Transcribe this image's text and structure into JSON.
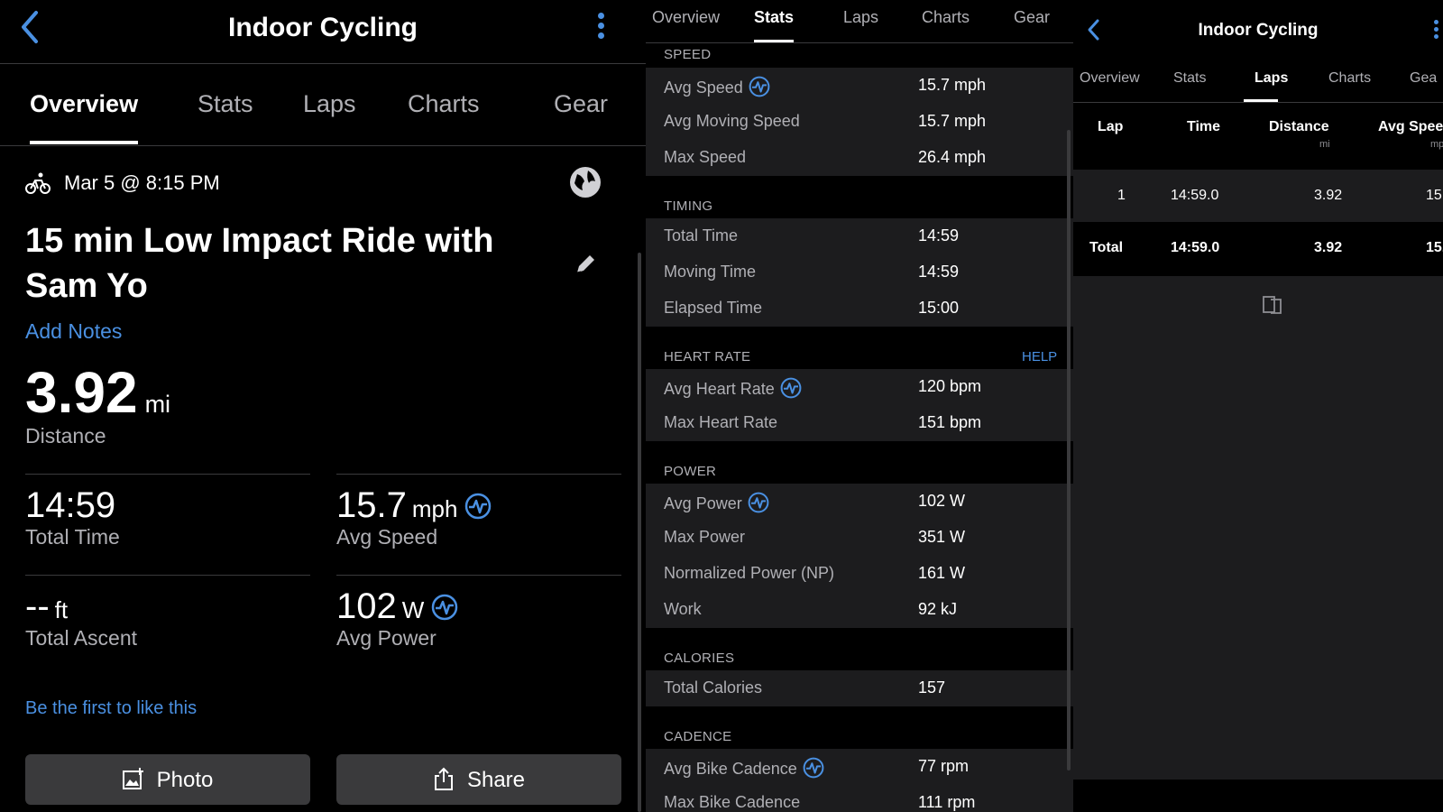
{
  "overview_panel": {
    "title": "Indoor Cycling",
    "tabs": [
      "Overview",
      "Stats",
      "Laps",
      "Charts",
      "Gear"
    ],
    "active_tab": "Overview",
    "date": "Mar 5 @ 8:15 PM",
    "activity_title": "15 min Low Impact Ride with Sam Yo",
    "add_notes": "Add Notes",
    "distance": {
      "value": "3.92",
      "unit": "mi",
      "label": "Distance"
    },
    "stats": [
      {
        "value": "14:59",
        "unit": "",
        "label": "Total Time"
      },
      {
        "value": "15.7",
        "unit": "mph",
        "label": "Avg Speed"
      },
      {
        "value": "--",
        "unit": "ft",
        "label": "Total Ascent"
      },
      {
        "value": "102",
        "unit": "W",
        "label": "Avg Power"
      }
    ],
    "like_text": "Be the first to like this",
    "photo_button": "Photo",
    "share_button": "Share"
  },
  "stats_panel": {
    "tabs": [
      "Overview",
      "Stats",
      "Laps",
      "Charts",
      "Gear"
    ],
    "active_tab": "Stats",
    "sections": {
      "speed": {
        "title": "SPEED",
        "rows": [
          {
            "label": "Avg Speed",
            "value": "15.7 mph"
          },
          {
            "label": "Avg Moving Speed",
            "value": "15.7 mph"
          },
          {
            "label": "Max Speed",
            "value": "26.4 mph"
          }
        ]
      },
      "timing": {
        "title": "TIMING",
        "rows": [
          {
            "label": "Total Time",
            "value": "14:59"
          },
          {
            "label": "Moving Time",
            "value": "14:59"
          },
          {
            "label": "Elapsed Time",
            "value": "15:00"
          }
        ]
      },
      "heart_rate": {
        "title": "HEART RATE",
        "help": "HELP",
        "rows": [
          {
            "label": "Avg Heart Rate",
            "value": "120 bpm"
          },
          {
            "label": "Max Heart Rate",
            "value": "151 bpm"
          }
        ]
      },
      "power": {
        "title": "POWER",
        "rows": [
          {
            "label": "Avg Power",
            "value": "102 W"
          },
          {
            "label": "Max Power",
            "value": "351 W"
          },
          {
            "label": "Normalized Power (NP)",
            "value": "161 W"
          },
          {
            "label": "Work",
            "value": "92 kJ"
          }
        ]
      },
      "calories": {
        "title": "CALORIES",
        "rows": [
          {
            "label": "Total Calories",
            "value": "157"
          }
        ]
      },
      "cadence": {
        "title": "CADENCE",
        "rows": [
          {
            "label": "Avg Bike Cadence",
            "value": "77 rpm"
          },
          {
            "label": "Max Bike Cadence",
            "value": "111 rpm"
          }
        ]
      }
    }
  },
  "laps_panel": {
    "title": "Indoor Cycling",
    "tabs": [
      "Overview",
      "Stats",
      "Laps",
      "Charts",
      "Gea"
    ],
    "active_tab": "Laps",
    "columns": [
      {
        "name": "Lap",
        "unit": ""
      },
      {
        "name": "Time",
        "unit": ""
      },
      {
        "name": "Distance",
        "unit": "mi"
      },
      {
        "name": "Avg Spee",
        "unit": "mp"
      }
    ],
    "rows": [
      [
        "1",
        "14:59.0",
        "3.92",
        "15."
      ],
      [
        "Total",
        "14:59.0",
        "3.92",
        "15."
      ]
    ]
  },
  "colors": {
    "background": "#000000",
    "accent": "#4a90e2",
    "row_background": "#1c1c1e",
    "secondary_text": "#b0b0b5"
  },
  "icons": [
    "back-chevron-icon",
    "more-vertical-icon",
    "bike-icon",
    "globe-icon",
    "pencil-icon",
    "pulse-icon",
    "photo-add-icon",
    "share-icon",
    "copy-icon"
  ]
}
